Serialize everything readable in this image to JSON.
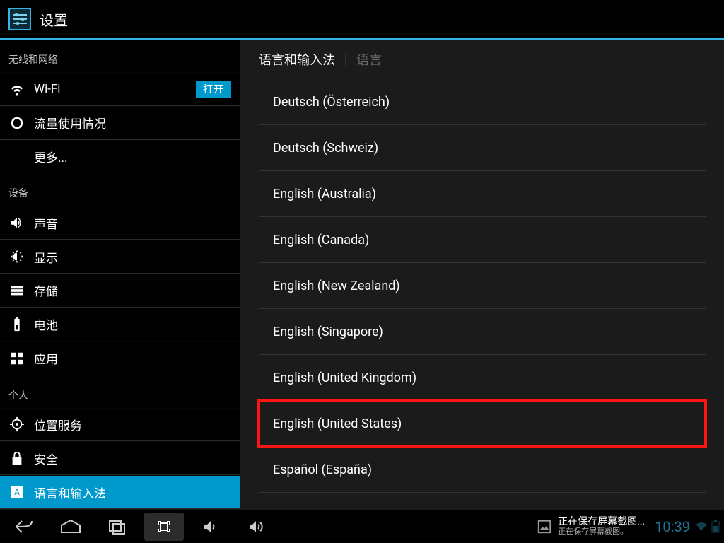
{
  "app": {
    "title": "设置"
  },
  "sidebar": {
    "sections": [
      {
        "header": "无线和网络",
        "items": [
          {
            "icon": "wifi",
            "label": "Wi-Fi",
            "switch": "打开"
          },
          {
            "icon": "data",
            "label": "流量使用情况"
          },
          {
            "icon": "",
            "label": "更多...",
            "indent": true
          }
        ]
      },
      {
        "header": "设备",
        "items": [
          {
            "icon": "sound",
            "label": "声音"
          },
          {
            "icon": "display",
            "label": "显示"
          },
          {
            "icon": "storage",
            "label": "存储"
          },
          {
            "icon": "battery",
            "label": "电池"
          },
          {
            "icon": "apps",
            "label": "应用"
          }
        ]
      },
      {
        "header": "个人",
        "items": [
          {
            "icon": "location",
            "label": "位置服务"
          },
          {
            "icon": "security",
            "label": "安全"
          },
          {
            "icon": "language",
            "label": "语言和输入法",
            "active": true
          }
        ]
      }
    ]
  },
  "content": {
    "header_title": "语言和输入法",
    "header_sub": "语言",
    "languages": [
      "Deutsch (Österreich)",
      "Deutsch (Schweiz)",
      "English (Australia)",
      "English (Canada)",
      "English (New Zealand)",
      "English (Singapore)",
      "English (United Kingdom)",
      "English (United States)",
      "Español (España)"
    ],
    "highlight_index": 7
  },
  "navbar": {
    "notification_title": "正在保存屏幕截图...",
    "notification_sub": "正在保存屏幕截图。",
    "clock": "10:39"
  }
}
